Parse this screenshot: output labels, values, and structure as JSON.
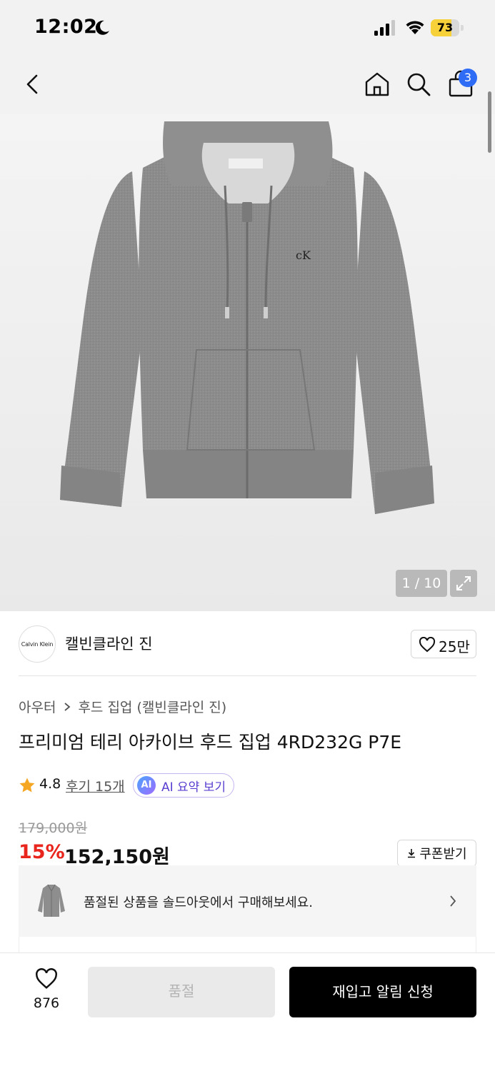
{
  "status_bar": {
    "time": "12:02",
    "battery_level": "73",
    "battery_fraction": 0.73
  },
  "header": {
    "cart_count": "3",
    "icons": [
      "back-icon",
      "home-icon",
      "search-icon",
      "shopping-bag-icon"
    ]
  },
  "gallery": {
    "counter": "1 / 10",
    "chest_logo": "cK"
  },
  "brand": {
    "logo_text": "Calvin Klein",
    "name": "캘빈클라인 진",
    "like_count": "25만"
  },
  "breadcrumb": {
    "category": "아우터",
    "subcategory": "후드 집업 (캘빈클라인 진)"
  },
  "product": {
    "title": "프리미엄 테리 아카이브 후드 집업 4RD232G P7E",
    "rating": "4.8",
    "review_link": "후기 15개",
    "ai_badge": "AI",
    "ai_summary_label": "AI 요약 보기",
    "original_price": "179,000원",
    "discount_rate": "15%",
    "sale_price": "152,150원",
    "coupon_label": "쿠폰받기"
  },
  "soldout_banner": {
    "text": "품절된 상품을 솔드아웃에서 구매해보세요."
  },
  "bottom_bar": {
    "wish_count": "876",
    "soldout_label": "품절",
    "restock_label": "재입고 알림 신청"
  },
  "colors": {
    "discount_red": "#e8261d",
    "cart_badge_blue": "#2f6cf6",
    "primary_black": "#000000",
    "battery_yellow": "#f7d13a"
  }
}
